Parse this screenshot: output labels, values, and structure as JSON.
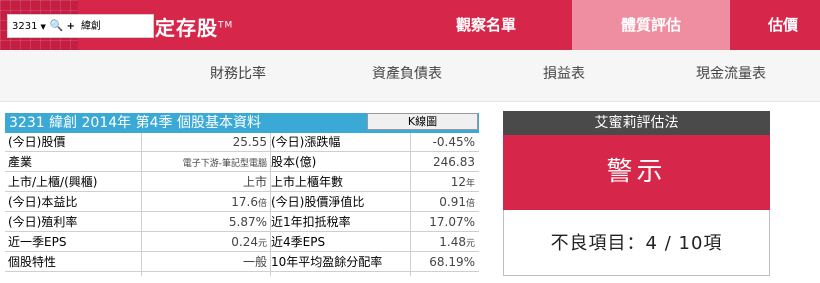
{
  "brand": {
    "name": "艾蜜莉定存股",
    "tm": "TM"
  },
  "topnav": [
    "觀察名單",
    "體質評估",
    "估價"
  ],
  "stock_selector": {
    "code": "3231",
    "name": "緯創"
  },
  "subnav": [
    "財務比率",
    "資產負債表",
    "損益表",
    "現金流量表"
  ],
  "info": {
    "title": "3231 緯創  2014年 第4季 個股基本資料",
    "kline_label": "K線圖",
    "rows": [
      {
        "l1": "(今日)股價",
        "v1": "25.55",
        "u1": "",
        "l2": "(今日)漲跌幅",
        "v2": "-0.45%",
        "u2": ""
      },
      {
        "l1": "產業",
        "v1": "電子下游-筆記型電腦",
        "u1": "",
        "l2": "股本(億)",
        "v2": "246.83",
        "u2": ""
      },
      {
        "l1": "上市/上櫃/(興櫃)",
        "v1": "上市",
        "u1": "",
        "l2": "上市上櫃年數",
        "v2": "12",
        "u2": "年"
      },
      {
        "l1": "(今日)本益比",
        "v1": "17.6",
        "u1": "倍",
        "l2": "(今日)股價淨值比",
        "v2": "0.91",
        "u2": "倍"
      },
      {
        "l1": "(今日)殖利率",
        "v1": "5.87%",
        "u1": "",
        "l2": "近1年扣抵稅率",
        "v2": "17.07%",
        "u2": ""
      },
      {
        "l1": "近一季EPS",
        "v1": "0.24",
        "u1": "元",
        "l2": "近4季EPS",
        "v2": "1.48",
        "u2": "元"
      },
      {
        "l1": "個股特性",
        "v1": "一般",
        "u1": "",
        "l2": "10年平均盈餘分配率",
        "v2": "68.19%",
        "u2": ""
      }
    ]
  },
  "evaluation": {
    "header": "艾蜜莉評估法",
    "verdict": "警示",
    "bad_items": "不良項目：4 / 10項"
  },
  "colors": {
    "brand": "#d6274b",
    "active_tab": "#ee8ea0",
    "table_header": "#3aa9d6",
    "eval_header": "#4a4a4a"
  }
}
